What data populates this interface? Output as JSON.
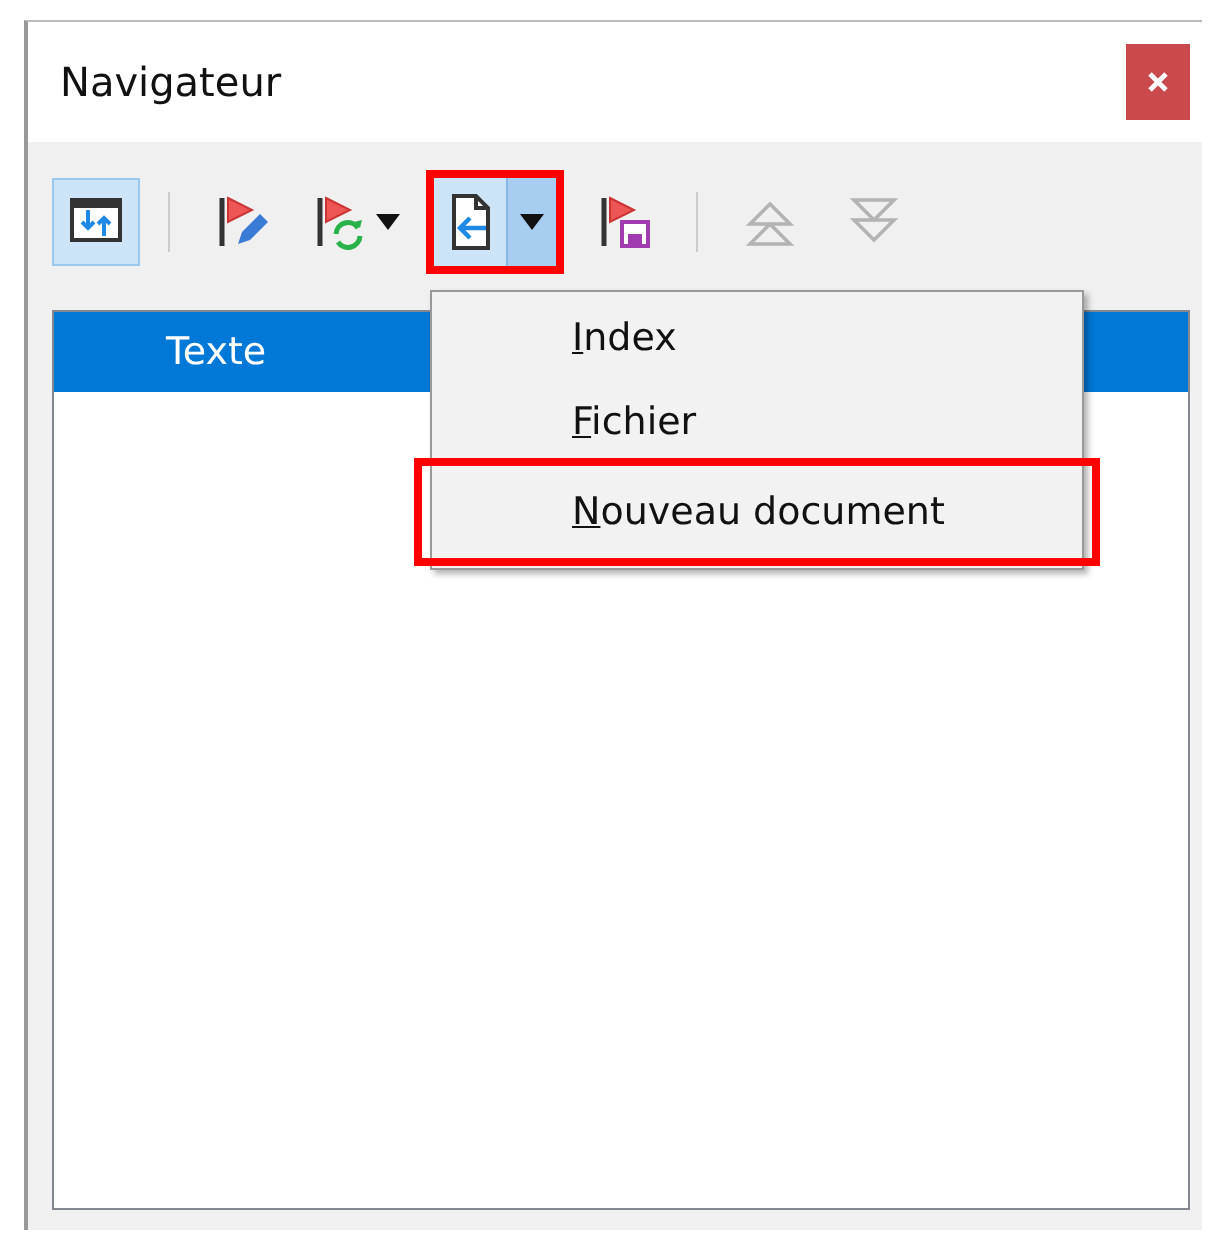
{
  "window": {
    "title": "Navigateur"
  },
  "toolbar": [
    {
      "kind": "toggle",
      "selected": true
    },
    {
      "kind": "separator"
    },
    {
      "kind": "button",
      "selected": false,
      "disabled": false
    },
    {
      "kind": "button",
      "selected": false,
      "disabled": false,
      "dropdown": true
    },
    {
      "kind": "split",
      "selected": true,
      "disabled": false,
      "dropdown": true,
      "highlighted": true
    },
    {
      "kind": "button",
      "selected": false,
      "disabled": false
    },
    {
      "kind": "separator"
    },
    {
      "kind": "button",
      "selected": false,
      "disabled": true
    },
    {
      "kind": "button",
      "selected": false,
      "disabled": true
    }
  ],
  "tree": {
    "items": [
      {
        "label": "Texte",
        "selected": true
      }
    ]
  },
  "menu": {
    "items": [
      {
        "label": "Index",
        "mnemonic_underlined": true,
        "highlighted": false
      },
      {
        "label": "Fichier",
        "mnemonic_underlined": true,
        "highlighted": false
      },
      {
        "label": "Nouveau document",
        "mnemonic_underlined": true,
        "highlighted": true
      }
    ]
  }
}
